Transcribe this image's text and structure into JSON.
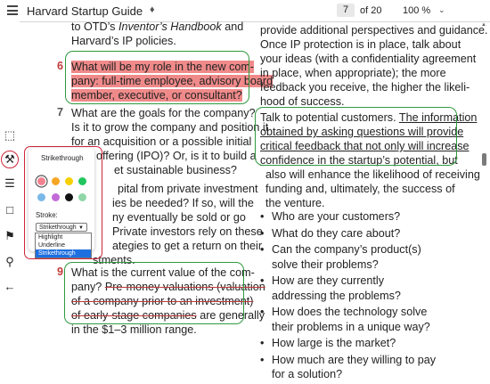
{
  "toolbar": {
    "title": "Harvard Startup Guide",
    "current_page": "7",
    "page_total": "of 20",
    "zoom": "100 %"
  },
  "popup": {
    "title": "Strikethrough",
    "stroke_label": "Stroke:",
    "selected_style": "Strikethrough",
    "options": [
      "Highlight",
      "Underline",
      "Strikethrough"
    ],
    "colors": [
      "#f2808f",
      "#f5a623",
      "#f7d000",
      "#22c55e",
      "#7ab8e8",
      "#c26ad7",
      "#111111",
      "#8fd6a8"
    ]
  },
  "left": {
    "l1": "to OTD’s ",
    "l1_em": "Inventor’s Handbook",
    "l1_end": " and",
    "l2": "Harvard’s IP policies.",
    "q6_num": "6",
    "q6_1": "What will be my role in the new com-",
    "q6_2": "pany: full-time employee, advisory board",
    "q6_3": "member, executive, or consultant?",
    "q7_num": "7",
    "q7_1": "What are the goals for the company?",
    "q7_2": "Is it to grow the company and position it",
    "q7_3": "for an acquisition or a possible initial",
    "q7_4": "offering (IPO)? Or, is it to build a",
    "q7_5": "et sustainable business?",
    "q8_1": "pital from private investment",
    "q8_2": "ies be needed? If so, will the",
    "q8_3": "ny eventually be sold or go",
    "q8_4": "Private investors rely on these",
    "q8_5": "ategies to get a return on their",
    "q8_6": "stments.",
    "q9_num": "9",
    "q9_1": "What is the current value of the com-",
    "q9_2a": "pany? ",
    "q9_2b": "Pre-money valuations (valuation",
    "q9_3": "of a company prior to an investment)",
    "q9_4": "of early-stage companies",
    "q9_4b": " are generally",
    "q9_5": "in the $1–3 million range."
  },
  "right": {
    "r1": "provide additional perspectives and guidance.",
    "r2": "Once IP protection is in place, talk about",
    "r3": "your ideas (with a confidentiality agreement",
    "r4": "in place, when appropriate); the more",
    "r5": "feedback you receive, the higher the likeli-",
    "r6": "hood of success.",
    "r7a": "Talk to potential customers. ",
    "r7b": "The information",
    "r8": "obtained by asking questions will provide",
    "r9": "critical feedback that not only will increase",
    "r10a": "confidence in the startup’s potential",
    "r10b": ", but",
    "r11": "also will enhance the likelihood of receiving",
    "r12": "funding and, ultimately, the success of",
    "r13": "the venture.",
    "bullets": [
      "Who are your customers?",
      "What do they care about?",
      "Can the company’s product(s) solve their problems?",
      "How are they currently addressing the problems?",
      "How does the technology solve their problems in a unique way?",
      "How large is the market?",
      "How much are they willing to pay for a solution?"
    ]
  }
}
